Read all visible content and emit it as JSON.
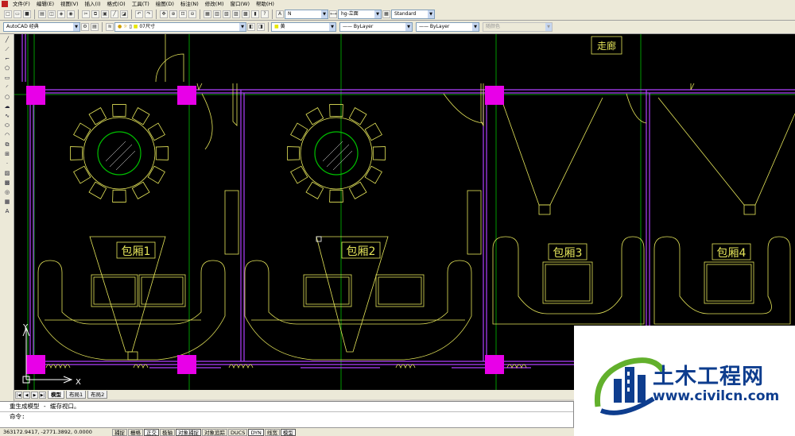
{
  "menu": [
    "文件(F)",
    "编辑(E)",
    "视图(V)",
    "插入(I)",
    "格式(O)",
    "工具(T)",
    "绘图(D)",
    "标注(N)",
    "修改(M)",
    "窗口(W)",
    "帮助(H)"
  ],
  "toolbar1": {
    "text_style": "N",
    "dim_style": "hg-立面",
    "table_style": "Standard"
  },
  "toolbar2": {
    "workspace": "AutoCAD 经典",
    "layer": "07尺寸",
    "color": "黄",
    "linetype": "ByLayer",
    "lineweight": "ByLayer",
    "plotstyle": "随颜色"
  },
  "drawing": {
    "corridor_label": "走廊",
    "room_labels": [
      "包厢1",
      "包厢2",
      "包厢3",
      "包厢4"
    ],
    "ucs_x": "X",
    "ucs_y": "Y",
    "colors": {
      "background": "#000000",
      "furniture": "#e6e65a",
      "walls": "#b040ff",
      "columns": "#e800e8",
      "grid": "#00d000",
      "white": "#ffffff"
    }
  },
  "tabs": [
    "模型",
    "布局1",
    "布局2"
  ],
  "active_tab": "模型",
  "command": {
    "history": "重生成模型 - 缓存视口。",
    "prompt": "命令:"
  },
  "status": {
    "coords": "363172.9417, -2771.3892, 0.0000",
    "buttons": [
      "捕捉",
      "栅格",
      "正交",
      "极轴",
      "对象捕捉",
      "对象追踪",
      "DUCS",
      "DYN",
      "线宽",
      "模型"
    ],
    "active": [
      "正交",
      "对象捕捉",
      "DYN",
      "模型"
    ]
  },
  "watermark": {
    "title": "土木工程网",
    "url": "www.civilcn.com",
    "colors": {
      "blue": "#0e3d8e",
      "green": "#62b02c"
    }
  }
}
